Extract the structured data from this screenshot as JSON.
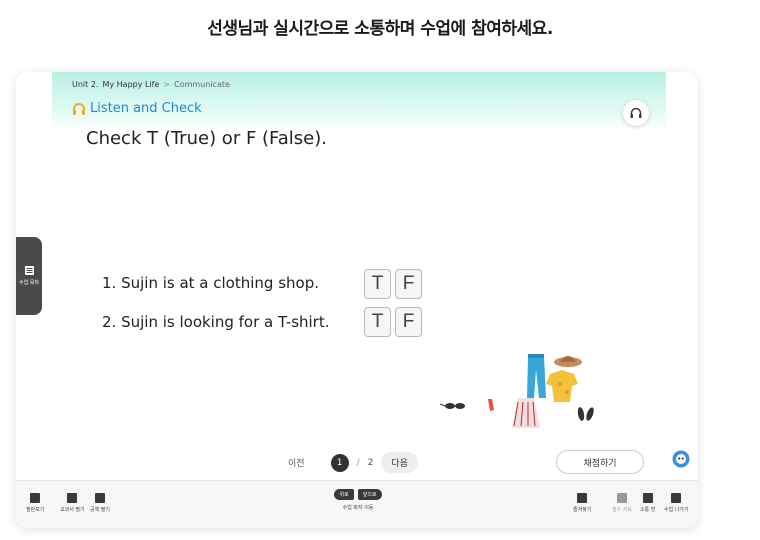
{
  "page_heading": "선생님과 실시간으로 소통하며 수업에 참여하세요.",
  "breadcrumb": {
    "unit": "Unit 2.",
    "unit_title": "My Happy Life",
    "separator": ">",
    "section": "Communicate"
  },
  "section_title": "Listen and Check",
  "instruction": "Check T (True) or F (False).",
  "side_tab": {
    "label": "수업 목차",
    "icon": "list-icon"
  },
  "questions": [
    {
      "text": "1. Sujin is at a clothing shop.",
      "true_label": "T",
      "false_label": "F"
    },
    {
      "text": "2. Sujin is looking for a T-shirt.",
      "true_label": "T",
      "false_label": "F"
    }
  ],
  "pager": {
    "prev_label": "이전",
    "current": "1",
    "slash": "/",
    "total": "2",
    "next_label": "다음"
  },
  "grade_button": "채점하기",
  "toolbar": {
    "left": [
      {
        "label": "필판보기",
        "icon": "laptop-icon"
      },
      {
        "label": "교과서 펼기",
        "icon": "book-icon"
      },
      {
        "label": "공책 펼기",
        "icon": "notebook-icon"
      }
    ],
    "nav": {
      "prev": "위로",
      "next": "앞으로",
      "label": "수업 화자 이동"
    },
    "right": [
      {
        "label": "즐겨찾기",
        "icon": "bookmark-icon",
        "dim": false
      },
      {
        "label": "필수 자료",
        "icon": "document-icon",
        "dim": true
      },
      {
        "label": "소통 방",
        "icon": "chat-icon",
        "dim": false
      },
      {
        "label": "수업 나가기",
        "icon": "exit-icon",
        "dim": false
      }
    ]
  },
  "colors": {
    "accent": "#1e88d8",
    "header_band": "#b8f0e4",
    "dark": "#333333"
  }
}
